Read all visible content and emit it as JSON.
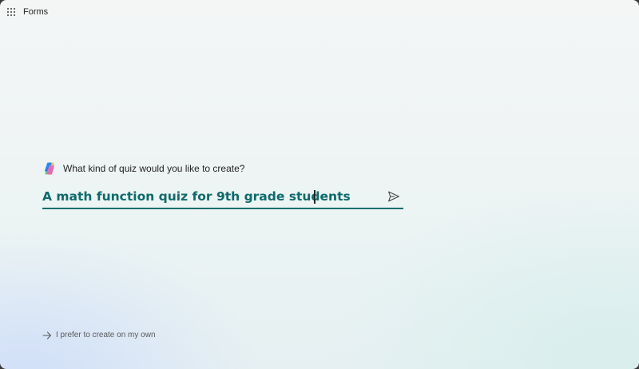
{
  "header": {
    "app_title": "Forms",
    "waffle_icon": "app-launcher-icon"
  },
  "prompt": {
    "icon": "copilot-icon",
    "question": "What kind of quiz would you like to create?",
    "input_value": "A math function quiz for 9th grade students",
    "send_icon": "send-icon"
  },
  "footer": {
    "own_link_label": "I prefer to create on my own",
    "own_link_icon": "arrow-right-icon"
  },
  "colors": {
    "accent": "#0f6d6d",
    "text": "#242424"
  }
}
